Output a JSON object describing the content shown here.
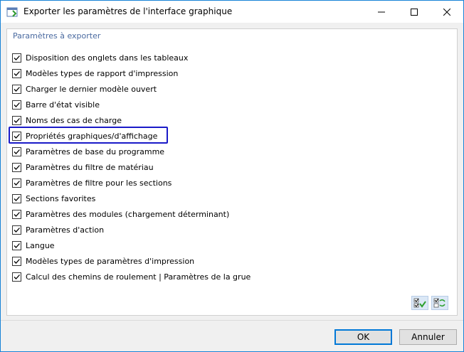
{
  "window": {
    "title": "Exporter les paramètres de l'interface graphique",
    "controls": {
      "minimize": "minimize-icon",
      "maximize": "maximize-icon",
      "close": "close-icon"
    }
  },
  "group": {
    "title": "Paramètres à exporter",
    "items": [
      {
        "label": "Disposition des onglets dans les tableaux",
        "checked": true
      },
      {
        "label": "Modèles types de rapport d'impression",
        "checked": true
      },
      {
        "label": "Charger le dernier modèle ouvert",
        "checked": true
      },
      {
        "label": "Barre d'état visible",
        "checked": true
      },
      {
        "label": "Noms des cas de charge",
        "checked": true
      },
      {
        "label": "Propriétés graphiques/d'affichage",
        "checked": true,
        "highlighted": true
      },
      {
        "label": "Paramètres de base du programme",
        "checked": true
      },
      {
        "label": "Paramètres du filtre de matériau",
        "checked": true
      },
      {
        "label": "Paramètres de filtre pour les sections",
        "checked": true
      },
      {
        "label": "Sections favorites",
        "checked": true
      },
      {
        "label": "Paramètres des modules (chargement déterminant)",
        "checked": true
      },
      {
        "label": "Paramètres d'action",
        "checked": true
      },
      {
        "label": "Langue",
        "checked": true
      },
      {
        "label": "Modèles types de paramètres d'impression",
        "checked": true
      },
      {
        "label": "Calcul des chemins de roulement | Paramètres de la grue",
        "checked": true
      }
    ]
  },
  "toolbar": {
    "check_all_icon": "check-all-icon",
    "uncheck_all_icon": "uncheck-all-icon"
  },
  "buttons": {
    "ok": "OK",
    "cancel": "Annuler"
  },
  "colors": {
    "highlight": "#1a1ac8",
    "group_title": "#4a6aa0",
    "window_border": "#1883d7"
  }
}
